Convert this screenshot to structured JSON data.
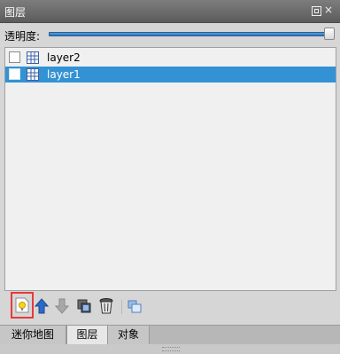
{
  "panel": {
    "title": "图层",
    "float_icon": "float-window-icon",
    "close_glyph": "×"
  },
  "opacity": {
    "label": "透明度:",
    "value_percent": 100
  },
  "layers": [
    {
      "name": "layer2",
      "checked": false,
      "selected": false,
      "icon": "grid-layer-icon"
    },
    {
      "name": "layer1",
      "checked": false,
      "selected": true,
      "icon": "grid-layer-icon"
    }
  ],
  "toolbar": {
    "buttons": [
      {
        "id": "new-layer",
        "icon": "new-layer-icon",
        "highlighted": true
      },
      {
        "id": "move-up",
        "icon": "arrow-up-icon"
      },
      {
        "id": "move-down",
        "icon": "arrow-down-icon"
      },
      {
        "id": "copy-layer",
        "icon": "copy-layer-icon"
      },
      {
        "id": "delete-layer",
        "icon": "trash-icon"
      },
      {
        "id": "bring-front",
        "icon": "bring-to-front-icon"
      }
    ]
  },
  "tabs": [
    {
      "label": "迷你地图",
      "active": false
    },
    {
      "label": "图层",
      "active": true
    },
    {
      "label": "对象",
      "active": false
    }
  ],
  "colors": {
    "selection": "#3392d3",
    "highlight_border": "#e63a3a",
    "titlebar": "#6a6a6a"
  }
}
